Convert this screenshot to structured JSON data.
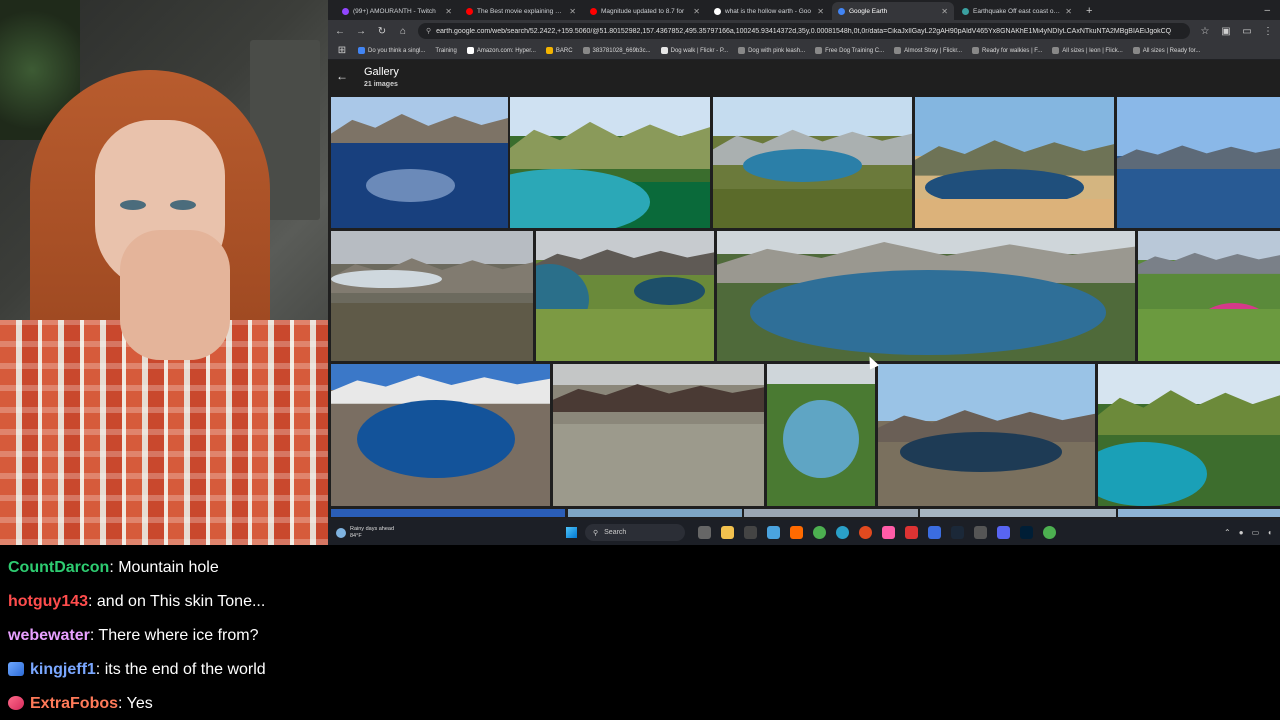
{
  "browser": {
    "tabs": [
      {
        "title": "(99+) AMOURANTH - Twitch",
        "color": "#9146ff",
        "active": false
      },
      {
        "title": "The Best movie explaining Noa",
        "color": "#ff0000",
        "active": false
      },
      {
        "title": "Magnitude updated to 8.7 for",
        "color": "#ff0000",
        "active": false
      },
      {
        "title": "what is the hollow earth - Goo",
        "color": "#ffffff",
        "active": false
      },
      {
        "title": "Google Earth",
        "color": "#4285f4",
        "active": true
      },
      {
        "title": "Earthquake Off east coast of K",
        "color": "#3aa0a0",
        "active": false
      }
    ],
    "url": "earth.google.com/web/search/52.2422,+159.5060/@51.80152982,157.4367852,495.35797166a,100245.93414372d,35y,0.00081548h,0t,0r/data=CikaJxIlGayL22gAH90pAldV465Yx8GNAKhE1Mi4yNDIyLCAxNTkuNTA2MBgBIAEiJgokCQ",
    "bookmarks": [
      "Do you think a singl...",
      "Training",
      "Amazon.com: Hyper...",
      "BARC",
      "383781028_669b3c...",
      "Dog walk | Flickr - P...",
      "Dog with pink leash...",
      "Free Dog Training C...",
      "Almost Stray | Flickr...",
      "Ready for walkies | F...",
      "All sizes | leon | Flick...",
      "All sizes | Ready for..."
    ]
  },
  "gallery": {
    "title": "Gallery",
    "count": "21 images"
  },
  "taskbar": {
    "weather": "Rainy days ahead",
    "temp": "84°F",
    "search_label": "Search"
  },
  "chat": [
    {
      "user": "CountDarcon",
      "text": ": Mountain hole",
      "color": "#2ecc71",
      "badge": ""
    },
    {
      "user": "hotguy143",
      "text": ": and on This skin Tone...",
      "color": "#ff4d4d",
      "badge": ""
    },
    {
      "user": "webewater",
      "text": ": There where ice from?",
      "color": "#e8a0ff",
      "badge": ""
    },
    {
      "user": "kingjeff1",
      "text": ": its the end of the world",
      "color": "#7aa7ff",
      "badge": "gift"
    },
    {
      "user": "ExtraFobos",
      "text": ": Yes",
      "color": "#ff7a59",
      "badge": "bits"
    }
  ]
}
